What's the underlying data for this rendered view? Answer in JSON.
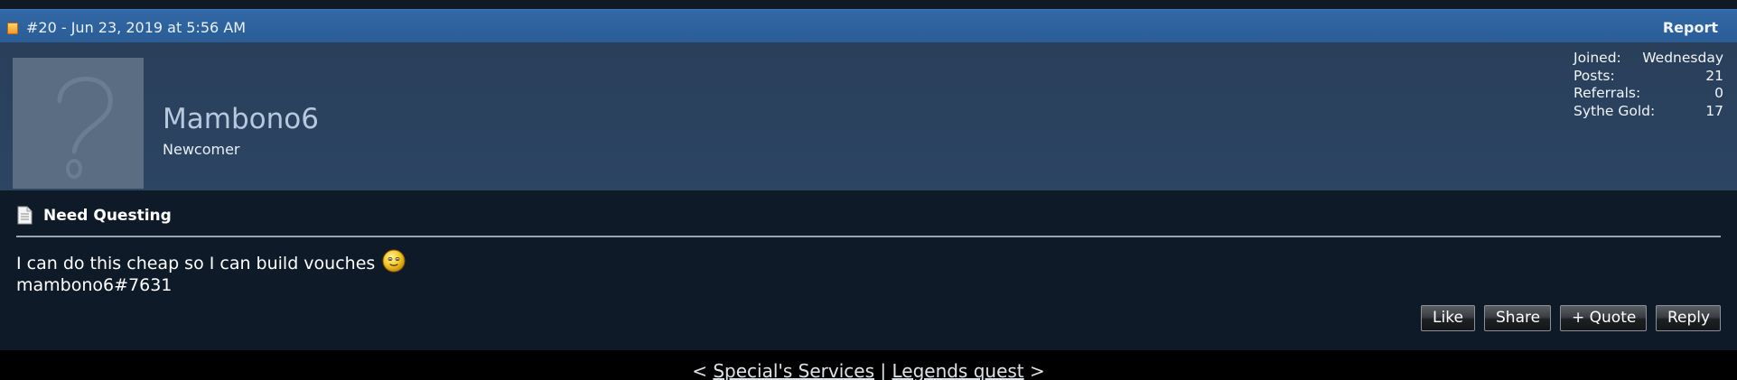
{
  "post": {
    "header": {
      "date": "#20 - Jun 23, 2019 at 5:56 AM",
      "report_label": "Report"
    },
    "user": {
      "username": "Mambono6",
      "title": "Newcomer",
      "stats": [
        {
          "label": "Joined:",
          "value": "Wednesday"
        },
        {
          "label": "Posts:",
          "value": "21"
        },
        {
          "label": "Referrals:",
          "value": "0"
        },
        {
          "label": "Sythe Gold:",
          "value": "17"
        }
      ]
    },
    "title": "Need Questing",
    "message": {
      "line1": "I can do this cheap so I can build vouches",
      "line2": "mambono6#7631"
    },
    "actions": {
      "like": "Like",
      "share": "Share",
      "quote": "+ Quote",
      "reply": "Reply"
    }
  },
  "thread_nav": {
    "prev_open": "<",
    "prev": "Special's Services",
    "separator": "|",
    "next": "Legends quest",
    "next_close": ">"
  },
  "colors": {
    "header_bar": "#2b5d96",
    "user_panel": "#2c4563",
    "post_body": "#0f1a28",
    "username": "#b8c9de",
    "page_background": "#000000"
  },
  "icons": {
    "status": "post-status-icon",
    "thread": "document-icon",
    "smiley": "embarrassed-smiley-icon",
    "avatar": "question-mark-avatar"
  }
}
